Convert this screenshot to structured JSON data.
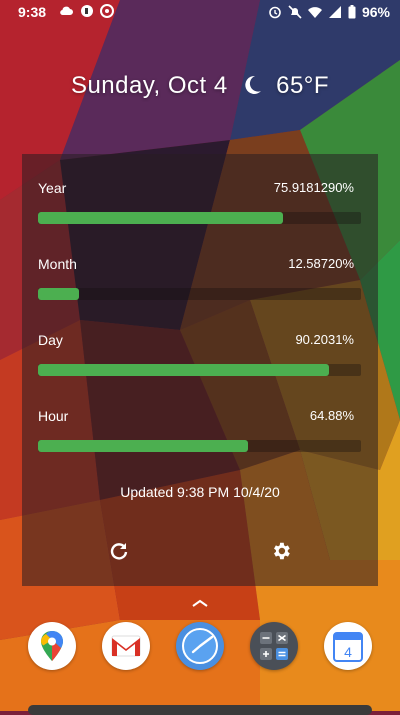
{
  "statusbar": {
    "time": "9:38",
    "battery": "96%",
    "left_icons": [
      "cloud-icon",
      "app-notification-icon",
      "app-notification-icon"
    ],
    "right_icons": [
      "alarm-icon",
      "mute-icon",
      "wifi-icon",
      "signal-icon",
      "battery-icon"
    ]
  },
  "header": {
    "date": "Sunday, Oct 4",
    "temperature": "65°F",
    "weather_icon": "moon-icon"
  },
  "widget": {
    "rows": [
      {
        "label": "Year",
        "value": "75.9181290%",
        "fraction": 0.75918129
      },
      {
        "label": "Month",
        "value": "12.58720%",
        "fraction": 0.125872
      },
      {
        "label": "Day",
        "value": "90.2031%",
        "fraction": 0.902031
      },
      {
        "label": "Hour",
        "value": "64.88%",
        "fraction": 0.6488
      }
    ],
    "updated": "Updated 9:38 PM 10/4/20",
    "bar_color": "#4caf50"
  },
  "dock": {
    "apps": [
      "maps-icon",
      "gmail-icon",
      "clock-icon",
      "calculator-icon",
      "calendar-icon"
    ],
    "calendar_day": "4"
  }
}
